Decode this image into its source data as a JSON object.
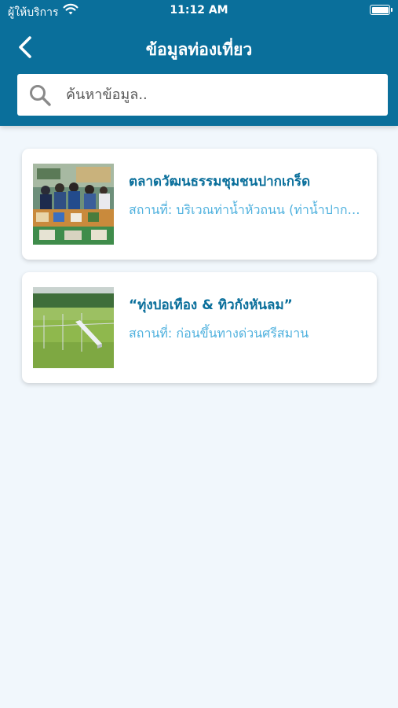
{
  "status_bar": {
    "carrier": "ผู้ให้บริการ",
    "time": "11:12 AM"
  },
  "nav": {
    "title": "ข้อมูลท่องเที่ยว",
    "back_icon": "chevron-left-icon"
  },
  "search": {
    "placeholder": "ค้นหาข้อมูล..",
    "value": "",
    "icon": "search-icon"
  },
  "places": [
    {
      "title": "ตลาดวัฒนธรรมชุมชนปากเกร็ด",
      "location": "สถานที่: บริเวณท่าน้ำหัวถนน (ท่าน้ำปากเกร็ด)"
    },
    {
      "title": "“ทุ่งปอเทือง & ทิวกังหันลม”",
      "location": "สถานที่: ก่อนขึ้นทางด่วนศรีสมาน"
    }
  ],
  "colors": {
    "header": "#0a6f9b",
    "background": "#f1f7fc",
    "title_text": "#0a6f9b",
    "location_text": "#4fb1de"
  }
}
